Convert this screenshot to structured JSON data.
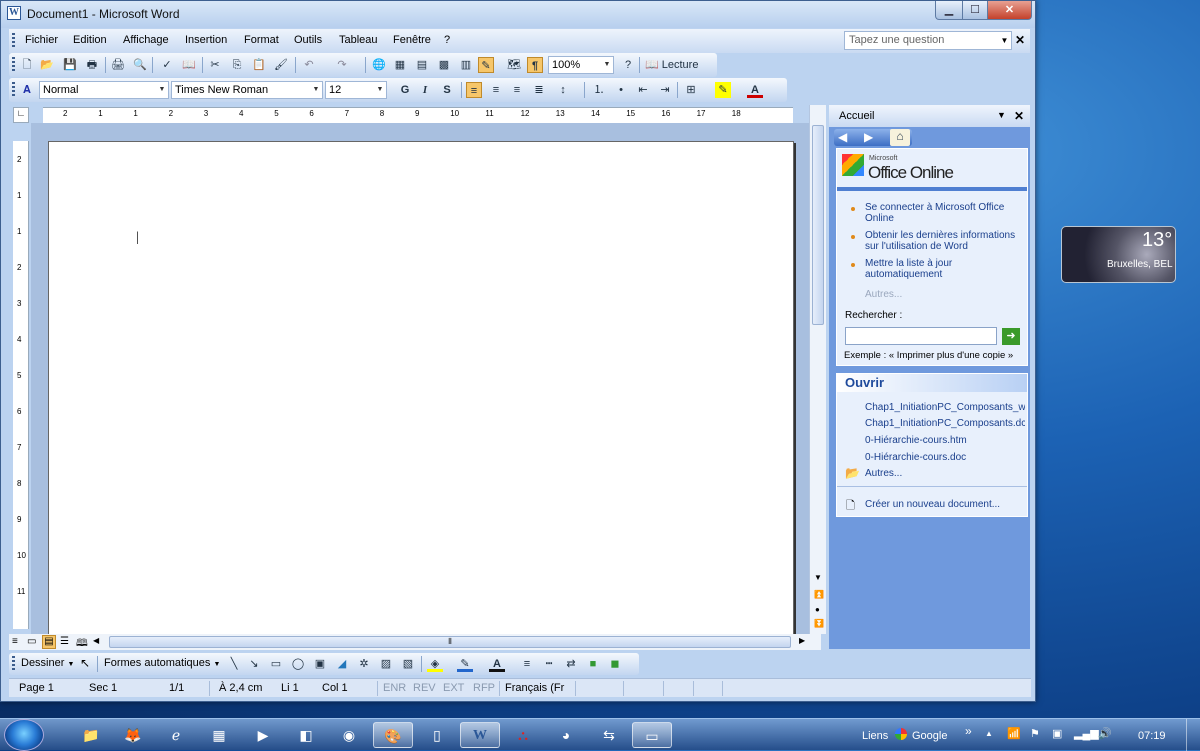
{
  "window": {
    "title": "Document1 - Microsoft Word",
    "app_icon": "W"
  },
  "menubar": {
    "items": [
      "Fichier",
      "Edition",
      "Affichage",
      "Insertion",
      "Format",
      "Outils",
      "Tableau",
      "Fenêtre",
      "?"
    ],
    "help_placeholder": "Tapez une question"
  },
  "standard_toolbar": {
    "zoom": "100%",
    "reading": "Lecture"
  },
  "format_toolbar": {
    "style": "Normal",
    "font": "Times New Roman",
    "size": "12",
    "bold": "G",
    "italic": "I",
    "shadow": "S"
  },
  "ruler": {
    "h_marks": [
      "2",
      "1",
      "1",
      "2",
      "3",
      "4",
      "5",
      "6",
      "7",
      "8",
      "9",
      "10",
      "11",
      "12",
      "13",
      "14",
      "15",
      "16",
      "17",
      "18"
    ],
    "v_marks": [
      "2",
      "1",
      "1",
      "2",
      "3",
      "4",
      "5",
      "6",
      "7",
      "8",
      "9",
      "10",
      "11"
    ]
  },
  "task_pane": {
    "title": "Accueil",
    "office_online_small": "Microsoft",
    "office_online": "Office Online",
    "links": [
      "Se connecter à Microsoft Office Online",
      "Obtenir les dernières informations sur l'utilisation de Word",
      "Mettre la liste à jour automatiquement"
    ],
    "more": "Autres...",
    "search_label": "Rechercher :",
    "example": "Exemple : « Imprimer plus d'une copie »",
    "open_title": "Ouvrir",
    "files": [
      "Chap1_InitiationPC_Composants_w",
      "Chap1_InitiationPC_Composants.dc",
      "0-Hiérarchie-cours.htm",
      "0-Hiérarchie-cours.doc"
    ],
    "open_more": "Autres...",
    "new_doc": "Créer un nouveau document..."
  },
  "drawing_toolbar": {
    "draw": "Dessiner",
    "autoshapes": "Formes automatiques"
  },
  "status": {
    "page": "Page  1",
    "sec": "Sec  1",
    "pages": "1/1",
    "at": "À 2,4 cm",
    "li": "Li  1",
    "col": "Col  1",
    "enr": "ENR",
    "rev": "REV",
    "ext": "EXT",
    "rfp": "RFP",
    "lang": "Français (Fr"
  },
  "gadget": {
    "temp": "13°",
    "city": "Bruxelles, BEL"
  },
  "taskbar": {
    "links": "Liens",
    "google": "Google",
    "clock": "07:19"
  },
  "colors": {
    "title_bar": "#c9dbf2",
    "task_pane": "#6f99dd",
    "accent_orange": "#e08a1a"
  }
}
